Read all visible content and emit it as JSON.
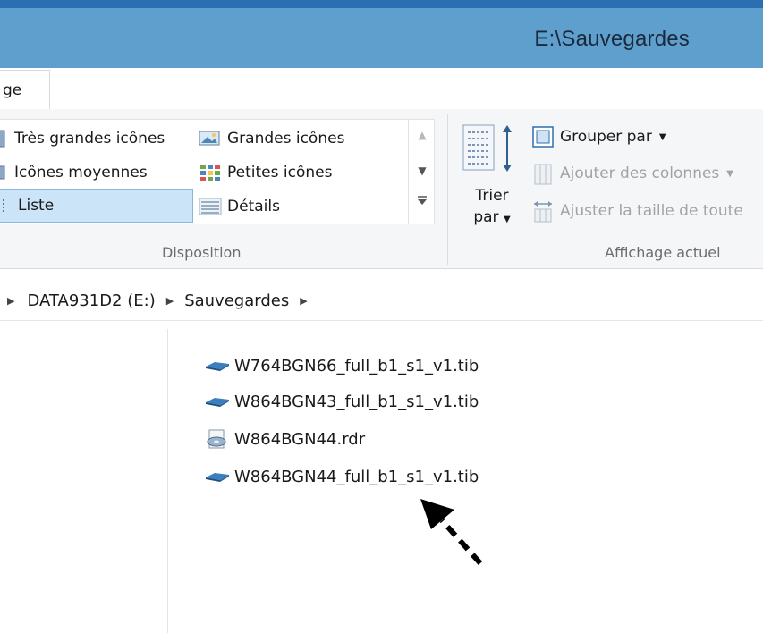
{
  "window": {
    "title": "E:\\Sauvegardes"
  },
  "ribbon": {
    "active_tab_label": "ge",
    "layout": {
      "items": [
        {
          "label": "Très grandes icônes",
          "icon": "extra-large-icons-icon"
        },
        {
          "label": "Grandes icônes",
          "icon": "large-icons-icon"
        },
        {
          "label": "Icônes moyennes",
          "icon": "medium-icons-icon"
        },
        {
          "label": "Petites icônes",
          "icon": "small-icons-icon"
        },
        {
          "label": "Liste",
          "icon": "list-icon",
          "selected": true
        },
        {
          "label": "Détails",
          "icon": "details-icon"
        }
      ],
      "group_label": "Disposition"
    },
    "current_view": {
      "sort_label_line1": "Trier",
      "sort_label_line2": "par",
      "group_by_label": "Grouper par",
      "add_columns_label": "Ajouter des colonnes",
      "fit_columns_label": "Ajuster la taille de toute",
      "group_label": "Affichage actuel"
    }
  },
  "addressbar": {
    "crumbs": [
      "DATA931D2 (E:)",
      "Sauvegardes"
    ]
  },
  "files": [
    {
      "name": "W764BGN66_full_b1_s1_v1.tib",
      "icon": "tib-file-icon"
    },
    {
      "name": "W864BGN43_full_b1_s1_v1.tib",
      "icon": "tib-file-icon"
    },
    {
      "name": "W864BGN44.rdr",
      "icon": "rdr-file-icon"
    },
    {
      "name": "W864BGN44_full_b1_s1_v1.tib",
      "icon": "tib-file-icon"
    }
  ],
  "colors": {
    "titlebar": "#5f9fcd",
    "selection": "#cce4f7",
    "selection_border": "#88b6dd"
  }
}
